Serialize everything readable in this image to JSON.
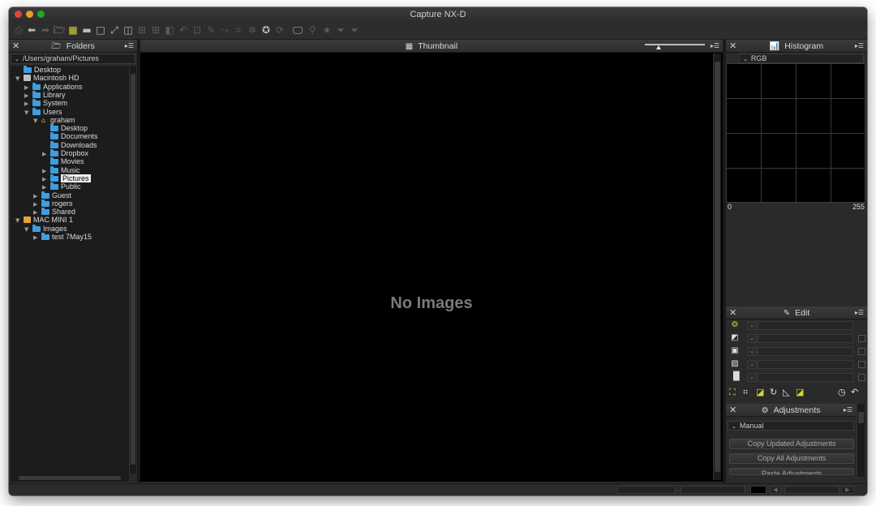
{
  "window": {
    "title": "Capture NX-D"
  },
  "folders_panel": {
    "title": "Folders",
    "path": "/Users/graham/Pictures",
    "tree": [
      {
        "label": "Desktop",
        "kind": "folder",
        "depth": 0,
        "expander": ""
      },
      {
        "label": "Macintosh HD",
        "kind": "drive",
        "depth": 0,
        "expander": "open"
      },
      {
        "label": "Applications",
        "kind": "folder",
        "depth": 1,
        "expander": "closed"
      },
      {
        "label": "Library",
        "kind": "folder",
        "depth": 1,
        "expander": "closed"
      },
      {
        "label": "System",
        "kind": "folder",
        "depth": 1,
        "expander": "closed"
      },
      {
        "label": "Users",
        "kind": "folder",
        "depth": 1,
        "expander": "open"
      },
      {
        "label": "graham",
        "kind": "home",
        "depth": 2,
        "expander": "open"
      },
      {
        "label": "Desktop",
        "kind": "folder",
        "depth": 3,
        "expander": ""
      },
      {
        "label": "Documents",
        "kind": "folder",
        "depth": 3,
        "expander": ""
      },
      {
        "label": "Downloads",
        "kind": "folder",
        "depth": 3,
        "expander": ""
      },
      {
        "label": "Dropbox",
        "kind": "folder",
        "depth": 3,
        "expander": "closed"
      },
      {
        "label": "Movies",
        "kind": "folder",
        "depth": 3,
        "expander": ""
      },
      {
        "label": "Music",
        "kind": "folder",
        "depth": 3,
        "expander": "closed"
      },
      {
        "label": "Pictures",
        "kind": "folder",
        "depth": 3,
        "expander": "closed",
        "selected": true
      },
      {
        "label": "Public",
        "kind": "folder",
        "depth": 3,
        "expander": "closed"
      },
      {
        "label": "Guest",
        "kind": "folder",
        "depth": 2,
        "expander": "closed"
      },
      {
        "label": "rogers",
        "kind": "folder",
        "depth": 2,
        "expander": "closed"
      },
      {
        "label": "Shared",
        "kind": "folder",
        "depth": 2,
        "expander": "closed"
      },
      {
        "label": "MAC MINI 1",
        "kind": "drive-orange",
        "depth": 0,
        "expander": "open"
      },
      {
        "label": "Images",
        "kind": "folder",
        "depth": 1,
        "expander": "open"
      },
      {
        "label": "test 7May15",
        "kind": "folder",
        "depth": 2,
        "expander": "closed"
      }
    ]
  },
  "thumbnail_panel": {
    "title": "Thumbnail",
    "empty_message": "No Images"
  },
  "histogram_panel": {
    "title": "Histogram",
    "channel": "RGB",
    "axis_min": "0",
    "axis_max": "255"
  },
  "edit_panel": {
    "title": "Edit"
  },
  "adjustments_panel": {
    "title": "Adjustments",
    "preset": "Manual",
    "buttons": [
      "Copy Updated Adjustments",
      "Copy All Adjustments",
      "Paste Adjustments"
    ]
  },
  "icons": {
    "close": "close-icon",
    "panel_menu": "panel-menu-icon",
    "folder": "folder-icon",
    "histogram": "histogram-icon",
    "edit": "edit-icon",
    "gear": "gear-icon",
    "grid": "grid-icon"
  },
  "colors": {
    "folder_blue": "#3d9ee0",
    "accent_yellow": "#d6d63a",
    "window_bg": "#2a2a2a"
  }
}
